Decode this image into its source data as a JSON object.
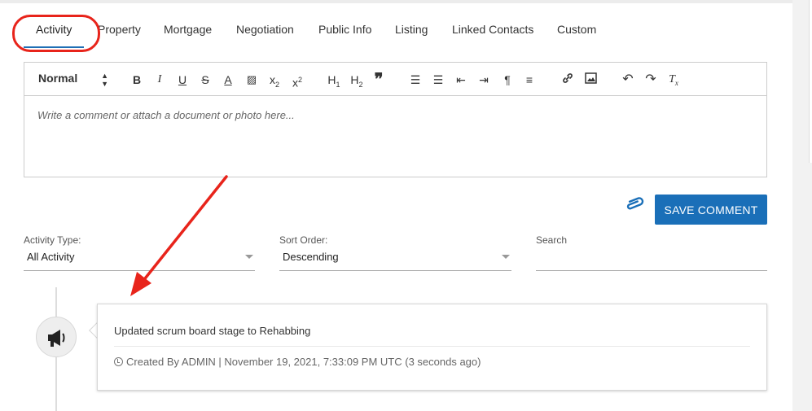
{
  "tabs": [
    {
      "label": "Activity",
      "active": true
    },
    {
      "label": "Property"
    },
    {
      "label": "Mortgage"
    },
    {
      "label": "Negotiation"
    },
    {
      "label": "Public Info"
    },
    {
      "label": "Listing"
    },
    {
      "label": "Linked Contacts"
    },
    {
      "label": "Custom"
    }
  ],
  "editor": {
    "format_value": "Normal",
    "placeholder": "Write a comment or attach a document or photo here...",
    "toolbar_icons": [
      "bold-icon",
      "italic-icon",
      "underline-icon",
      "strikethrough-icon",
      "font-color-icon",
      "highlight-icon",
      "subscript-icon",
      "superscript-icon",
      "heading-1-icon",
      "heading-2-icon",
      "blockquote-icon",
      "ordered-list-icon",
      "bullet-list-icon",
      "outdent-icon",
      "indent-icon",
      "text-direction-icon",
      "align-icon",
      "link-icon",
      "image-icon",
      "undo-icon",
      "redo-icon",
      "clear-format-icon"
    ]
  },
  "actions": {
    "save_label": "SAVE COMMENT",
    "attach_icon": "paperclip-icon"
  },
  "filters": {
    "activity_type_label": "Activity Type:",
    "activity_type_value": "All Activity",
    "sort_order_label": "Sort Order:",
    "sort_order_value": "Descending",
    "search_label": "Search"
  },
  "timeline": {
    "items": [
      {
        "icon": "megaphone-icon",
        "title": "Updated scrum board stage to Rehabbing",
        "meta": "Created By ADMIN | November 19, 2021, 7:33:09 PM UTC (3 seconds ago)"
      }
    ]
  },
  "colors": {
    "accent": "#1a6fb8",
    "annotation": "#e8241b"
  }
}
